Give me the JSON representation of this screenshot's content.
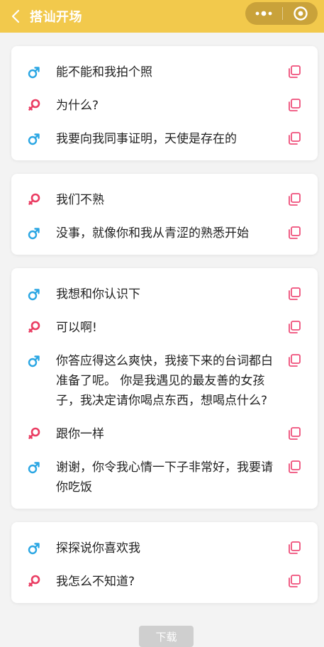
{
  "header": {
    "title": "搭讪开场",
    "bg_color": "#f2c94c"
  },
  "colors": {
    "male": "#2aa6e3",
    "female": "#ea3c62",
    "copy": "#ef4f7a"
  },
  "groups": [
    {
      "lines": [
        {
          "gender": "male",
          "icon": "male-icon",
          "text": "能不能和我拍个照"
        },
        {
          "gender": "female",
          "icon": "female-icon",
          "text": "为什么?"
        },
        {
          "gender": "male",
          "icon": "male-icon",
          "text": "我要向我同事证明，天使是存在的"
        }
      ]
    },
    {
      "lines": [
        {
          "gender": "female",
          "icon": "female-icon",
          "text": "我们不熟"
        },
        {
          "gender": "male",
          "icon": "male-icon",
          "text": "没事，就像你和我从青涩的熟悉开始"
        }
      ]
    },
    {
      "lines": [
        {
          "gender": "male",
          "icon": "male-icon",
          "text": "我想和你认识下"
        },
        {
          "gender": "female",
          "icon": "female-icon",
          "text": "可以啊!"
        },
        {
          "gender": "male",
          "icon": "male-icon",
          "text": "你答应得这么爽快，我接下来的台词都白准备了呢。 你是我遇见的最友善的女孩子，我决定请你喝点东西，想喝点什么?"
        },
        {
          "gender": "female",
          "icon": "female-icon",
          "text": "跟你一样"
        },
        {
          "gender": "male",
          "icon": "male-icon",
          "text": "谢谢，你令我心情一下子非常好，我要请你吃饭"
        }
      ]
    },
    {
      "lines": [
        {
          "gender": "male",
          "icon": "male-icon",
          "text": "探探说你喜欢我"
        },
        {
          "gender": "female",
          "icon": "female-icon",
          "text": "我怎么不知道?"
        }
      ]
    }
  ],
  "download_label": "下载"
}
